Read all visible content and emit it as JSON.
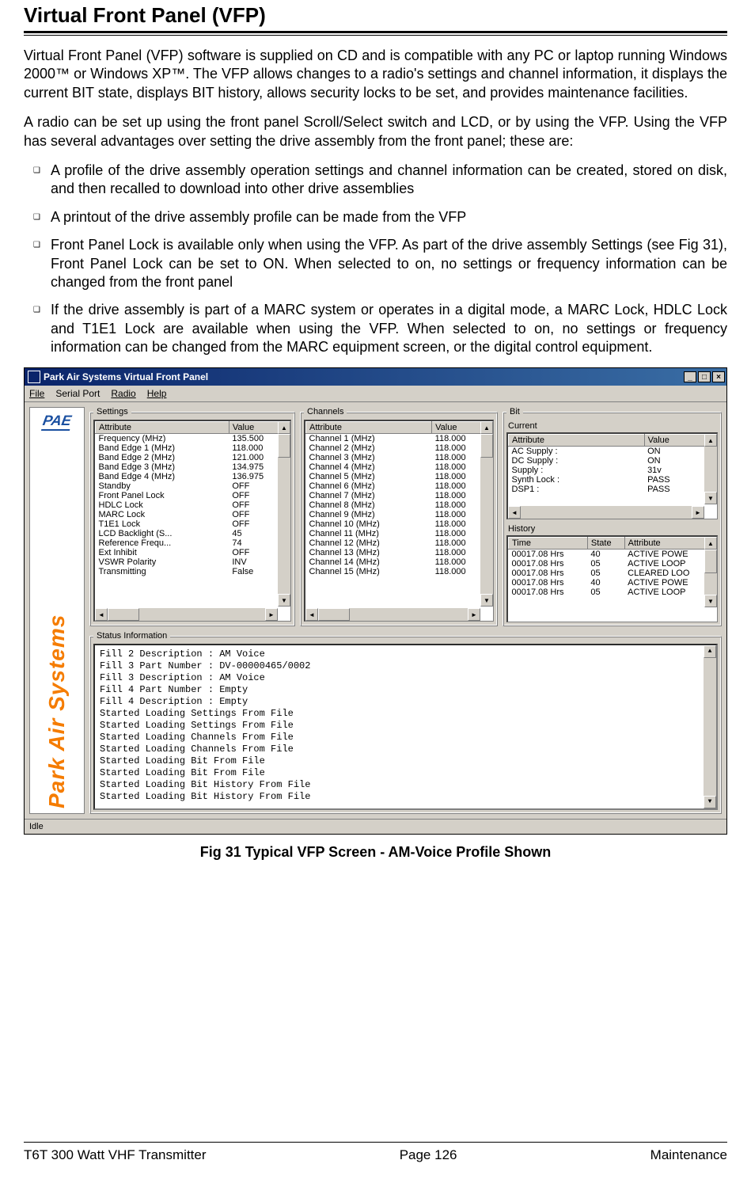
{
  "page": {
    "title": "Virtual Front Panel (VFP)",
    "para1": "Virtual Front Panel (VFP) software is supplied on CD and is compatible with any PC or laptop running Windows 2000™ or Windows XP™. The VFP allows changes to a radio's settings and channel information, it displays the current BIT state, displays BIT history, allows security locks to be set, and provides maintenance facilities.",
    "para2": "A radio can be set up using the front panel Scroll/Select switch and LCD, or by using the VFP. Using the VFP has several advantages over setting the drive assembly from the front panel; these are:",
    "bullets": [
      "A profile of the drive assembly operation settings and channel information can be created, stored on disk, and then recalled to download into other drive assemblies",
      "A printout of the drive assembly profile can be made from the VFP",
      "Front Panel Lock is available only when using the VFP. As part of the drive assembly Settings (see Fig 31), Front Panel Lock can be set to ON. When selected to on, no settings or frequency information can be changed from the front panel",
      "If the drive assembly is part of a MARC system or operates in a digital mode, a MARC Lock, HDLC Lock and T1E1 Lock are available when using the VFP. When selected to on, no settings or frequency information can be changed from the MARC equipment screen, or the digital control equipment."
    ],
    "caption": "Fig 31  Typical VFP Screen - AM-Voice Profile Shown"
  },
  "footer": {
    "left": "T6T 300 Watt VHF Transmitter",
    "center": "Page 126",
    "right": "Maintenance"
  },
  "app": {
    "window_title": "Park Air Systems Virtual Front Panel",
    "menus": [
      "File",
      "Serial Port",
      "Radio",
      "Help"
    ],
    "logo_top": "PAE",
    "logo_side": "Park Air Systems",
    "statusbar": "Idle",
    "groups": {
      "settings": {
        "legend": "Settings",
        "headers": [
          "Attribute",
          "Value"
        ],
        "rows": [
          [
            "Frequency (MHz)",
            "135.500"
          ],
          [
            "Band Edge 1 (MHz)",
            "118.000"
          ],
          [
            "Band Edge 2 (MHz)",
            "121.000"
          ],
          [
            "Band Edge 3 (MHz)",
            "134.975"
          ],
          [
            "Band Edge 4 (MHz)",
            "136.975"
          ],
          [
            "Standby",
            "OFF"
          ],
          [
            "Front Panel Lock",
            "OFF"
          ],
          [
            "HDLC Lock",
            "OFF"
          ],
          [
            "MARC Lock",
            "OFF"
          ],
          [
            "T1E1 Lock",
            "OFF"
          ],
          [
            "LCD Backlight (S...",
            "45"
          ],
          [
            "Reference Frequ...",
            "74"
          ],
          [
            "Ext Inhibit",
            "OFF"
          ],
          [
            "VSWR Polarity",
            "INV"
          ],
          [
            "Transmitting",
            "False"
          ]
        ]
      },
      "channels": {
        "legend": "Channels",
        "headers": [
          "Attribute",
          "Value"
        ],
        "rows": [
          [
            "Channel 1   (MHz)",
            "118.000"
          ],
          [
            "Channel 2   (MHz)",
            "118.000"
          ],
          [
            "Channel 3   (MHz)",
            "118.000"
          ],
          [
            "Channel 4   (MHz)",
            "118.000"
          ],
          [
            "Channel 5   (MHz)",
            "118.000"
          ],
          [
            "Channel 6   (MHz)",
            "118.000"
          ],
          [
            "Channel 7   (MHz)",
            "118.000"
          ],
          [
            "Channel 8   (MHz)",
            "118.000"
          ],
          [
            "Channel 9   (MHz)",
            "118.000"
          ],
          [
            "Channel 10  (MHz)",
            "118.000"
          ],
          [
            "Channel 11  (MHz)",
            "118.000"
          ],
          [
            "Channel 12  (MHz)",
            "118.000"
          ],
          [
            "Channel 13  (MHz)",
            "118.000"
          ],
          [
            "Channel 14  (MHz)",
            "118.000"
          ],
          [
            "Channel 15  (MHz)",
            "118.000"
          ]
        ]
      },
      "bit": {
        "legend": "Bit",
        "current_label": "Current",
        "current_headers": [
          "Attribute",
          "Value"
        ],
        "current_rows": [
          [
            "AC Supply :",
            "ON"
          ],
          [
            "DC Supply :",
            "ON"
          ],
          [
            "Supply :",
            "31v"
          ],
          [
            "Synth Lock :",
            "PASS"
          ],
          [
            "DSP1 :",
            "PASS"
          ]
        ],
        "history_label": "History",
        "history_headers": [
          "Time",
          "State",
          "Attribute"
        ],
        "history_rows": [
          [
            "00017.08 Hrs",
            "40",
            "ACTIVE POWE"
          ],
          [
            "00017.08 Hrs",
            "05",
            "ACTIVE LOOP"
          ],
          [
            "00017.08 Hrs",
            "05",
            "CLEARED LOO"
          ],
          [
            "00017.08 Hrs",
            "40",
            "ACTIVE POWE"
          ],
          [
            "00017.08 Hrs",
            "05",
            "ACTIVE LOOP"
          ]
        ]
      },
      "status": {
        "legend": "Status Information",
        "lines": [
          "Fill 2 Description : AM Voice",
          "Fill 3 Part Number : DV-00000465/0002",
          "Fill 3 Description : AM Voice",
          "Fill 4 Part Number : Empty",
          "Fill 4 Description : Empty",
          "Started Loading Settings From File",
          "Started Loading Settings From File",
          "Started Loading Channels From File",
          "Started Loading Channels From File",
          "Started Loading Bit From File",
          "Started Loading Bit From File",
          "Started Loading Bit History From File",
          "Started Loading Bit History From File"
        ]
      }
    }
  }
}
